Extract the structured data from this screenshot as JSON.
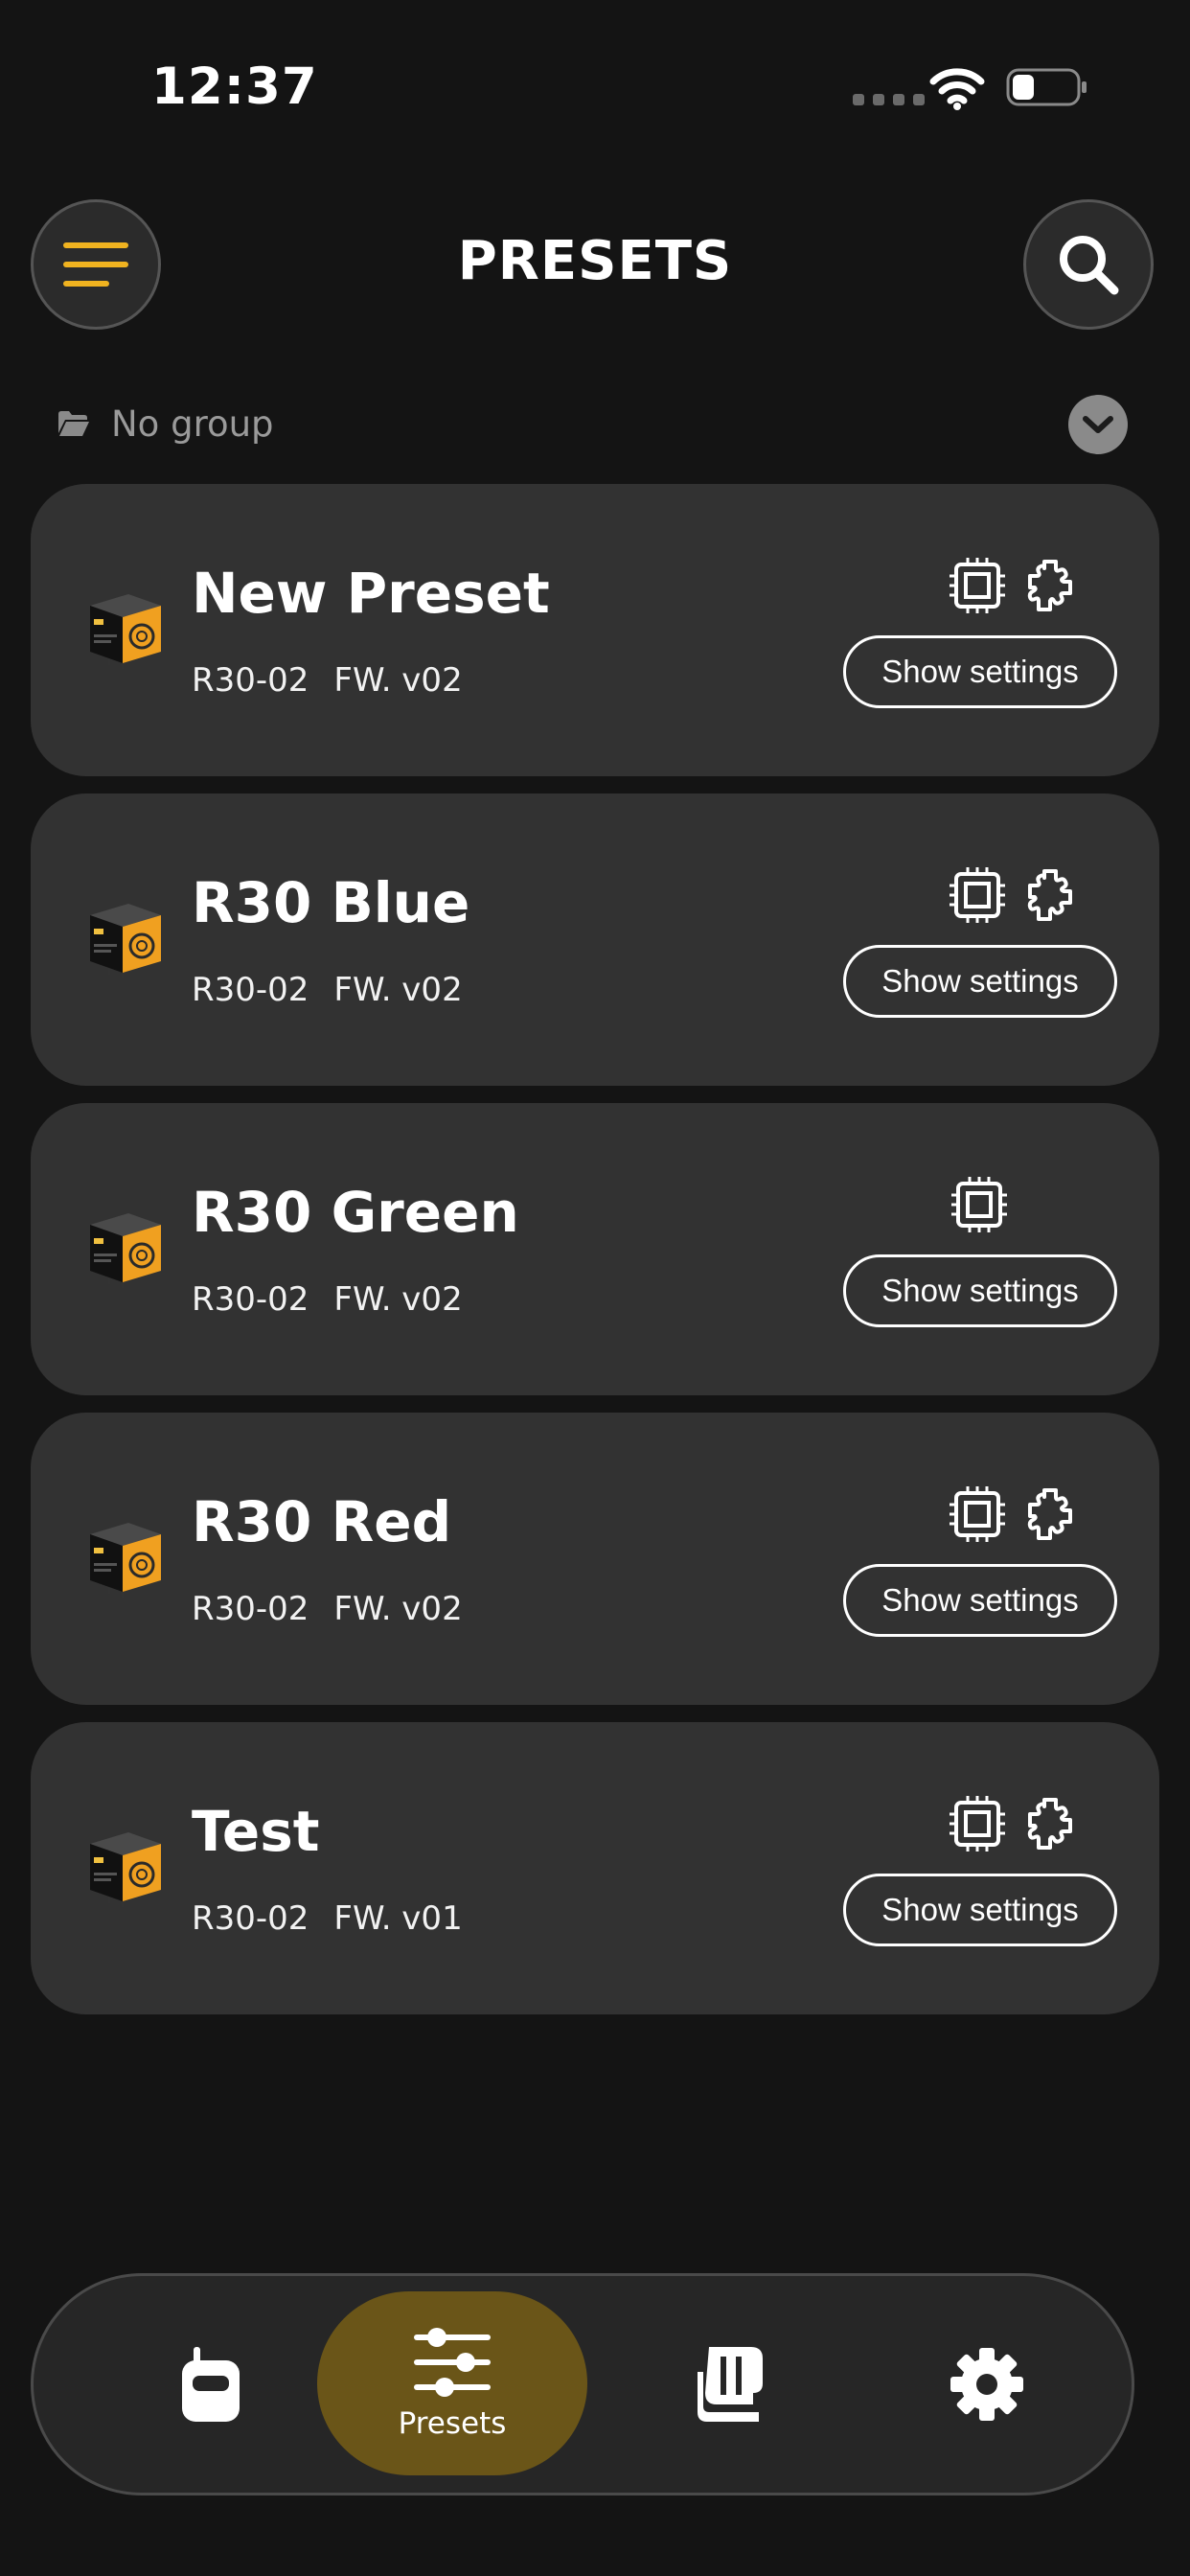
{
  "status_bar": {
    "time": "12:37"
  },
  "header": {
    "title": "PRESETS"
  },
  "group": {
    "label": "No group"
  },
  "presets": [
    {
      "name": "New Preset",
      "model": "R30-02",
      "firmware": "FW. v02",
      "button": "Show settings",
      "icons": [
        "chip-icon",
        "puzzle-icon"
      ]
    },
    {
      "name": "R30 Blue",
      "model": "R30-02",
      "firmware": "FW. v02",
      "button": "Show settings",
      "icons": [
        "chip-icon",
        "puzzle-icon"
      ]
    },
    {
      "name": "R30 Green",
      "model": "R30-02",
      "firmware": "FW. v02",
      "button": "Show settings",
      "icons": [
        "chip-icon"
      ]
    },
    {
      "name": "R30 Red",
      "model": "R30-02",
      "firmware": "FW. v02",
      "button": "Show settings",
      "icons": [
        "chip-icon",
        "puzzle-icon"
      ]
    },
    {
      "name": "Test",
      "model": "R30-02",
      "firmware": "FW. v01",
      "button": "Show settings",
      "icons": [
        "chip-icon",
        "puzzle-icon"
      ]
    }
  ],
  "nav": {
    "items": [
      {
        "icon": "radio-icon",
        "label": ""
      },
      {
        "icon": "sliders-icon",
        "label": "Presets",
        "active": true
      },
      {
        "icon": "library-icon",
        "label": ""
      },
      {
        "icon": "gear-icon",
        "label": ""
      }
    ]
  },
  "colors": {
    "accent": "#f0b320",
    "active_nav": "#6a5518",
    "card": "#323232",
    "background": "#141414"
  }
}
